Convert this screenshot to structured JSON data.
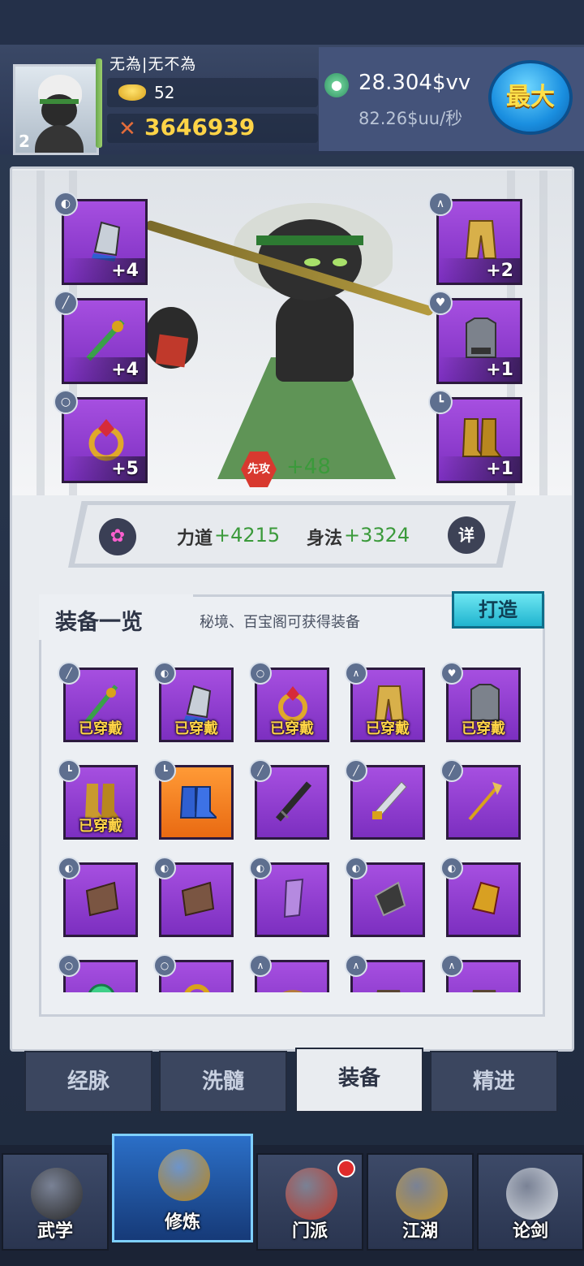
{
  "player": {
    "name": "无為|无不為",
    "level": "2",
    "gold": "52",
    "power": "3646939"
  },
  "income": {
    "total": "28.304$vv",
    "rate": "82.26$uu/秒",
    "max_label": "最大"
  },
  "equipped": {
    "left": [
      {
        "type_icon": "bracer-icon",
        "level": "+4"
      },
      {
        "type_icon": "weapon-icon",
        "level": "+4"
      },
      {
        "type_icon": "ring-icon",
        "level": "+5"
      }
    ],
    "right": [
      {
        "type_icon": "pants-icon",
        "level": "+2"
      },
      {
        "type_icon": "armor-icon",
        "level": "+1"
      },
      {
        "type_icon": "boots-icon",
        "level": "+1"
      }
    ]
  },
  "initiative": {
    "badge": "先攻",
    "value": "+48"
  },
  "stats": {
    "strength_label": "力道",
    "strength_value": "+4215",
    "agility_label": "身法",
    "agility_value": "+3324",
    "detail_label": "详"
  },
  "equipment_list": {
    "title": "装备一览",
    "subtitle": "秘境、百宝阁可获得装备",
    "forge_label": "打造",
    "worn_label": "已穿戴",
    "items": [
      {
        "badge": "weapon-icon",
        "art": "flute-gourd",
        "worn": true,
        "rarity": "purple"
      },
      {
        "badge": "bracer-icon",
        "art": "bracer",
        "worn": true,
        "rarity": "purple"
      },
      {
        "badge": "ring-icon",
        "art": "ruby-ring",
        "worn": true,
        "rarity": "purple"
      },
      {
        "badge": "pants-icon",
        "art": "gold-pants",
        "worn": true,
        "rarity": "purple"
      },
      {
        "badge": "armor-icon",
        "art": "iron-vest",
        "worn": true,
        "rarity": "purple"
      },
      {
        "badge": "boots-icon",
        "art": "gold-boots",
        "worn": true,
        "rarity": "purple"
      },
      {
        "badge": "boots-icon",
        "art": "blue-boots",
        "worn": false,
        "rarity": "orange"
      },
      {
        "badge": "weapon-icon",
        "art": "black-sword",
        "worn": false,
        "rarity": "purple"
      },
      {
        "badge": "weapon-icon",
        "art": "gold-dagger",
        "worn": false,
        "rarity": "purple"
      },
      {
        "badge": "weapon-icon",
        "art": "trident-staff",
        "worn": false,
        "rarity": "purple"
      },
      {
        "badge": "bracer-icon",
        "art": "leather-bracer",
        "worn": false,
        "rarity": "purple"
      },
      {
        "badge": "bracer-icon",
        "art": "leather-bracer",
        "worn": false,
        "rarity": "purple"
      },
      {
        "badge": "bracer-icon",
        "art": "violet-bracer",
        "worn": false,
        "rarity": "purple"
      },
      {
        "badge": "bracer-icon",
        "art": "steel-bracer",
        "worn": false,
        "rarity": "purple"
      },
      {
        "badge": "bracer-icon",
        "art": "dragon-bracer",
        "worn": false,
        "rarity": "purple"
      },
      {
        "badge": "ring-icon",
        "art": "jade-ring",
        "worn": false,
        "rarity": "purple"
      },
      {
        "badge": "ring-icon",
        "art": "gold-ring",
        "worn": false,
        "rarity": "purple"
      },
      {
        "badge": "pants-icon",
        "art": "cloth-pants",
        "worn": false,
        "rarity": "purple"
      },
      {
        "badge": "pants-icon",
        "art": "dark-pants",
        "worn": false,
        "rarity": "purple"
      },
      {
        "badge": "pants-icon",
        "art": "dark-pants",
        "worn": false,
        "rarity": "purple"
      }
    ]
  },
  "sub_tabs": [
    {
      "label": "经脉",
      "active": false
    },
    {
      "label": "洗髓",
      "active": false
    },
    {
      "label": "装备",
      "active": true
    },
    {
      "label": "精进",
      "active": false
    }
  ],
  "bottom_nav": [
    {
      "label": "武学",
      "active": false,
      "icon": "ninja-icon"
    },
    {
      "label": "修炼",
      "active": true,
      "icon": "meditation-icon"
    },
    {
      "label": "门派",
      "active": false,
      "icon": "gate-icon",
      "notify": true
    },
    {
      "label": "江湖",
      "active": false,
      "icon": "gourd-icon"
    },
    {
      "label": "论剑",
      "active": false,
      "icon": "sword-icon"
    }
  ],
  "colors": {
    "purple_slot": "#9a45d8",
    "orange_slot": "#f58423",
    "stat_green": "#3b9a3b",
    "gold_text": "#ffd447",
    "forge_button": "#3fcde0"
  }
}
